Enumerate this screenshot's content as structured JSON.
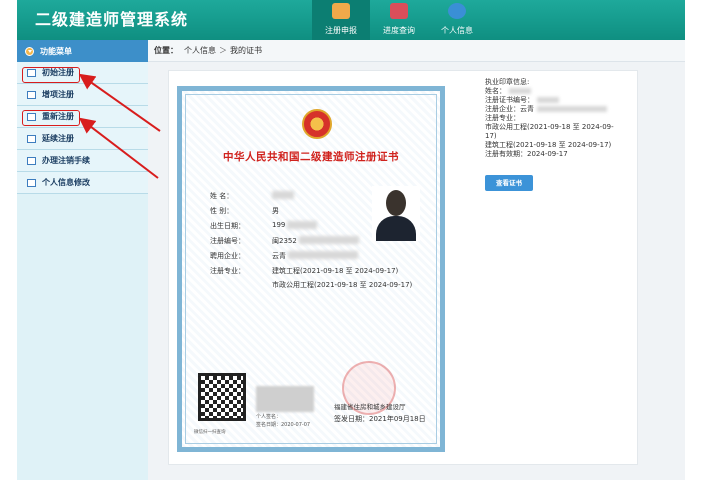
{
  "app": {
    "title": "二级建造师管理系统",
    "topnav": [
      {
        "label": "注册申报",
        "icon": "home-icon",
        "active": true
      },
      {
        "label": "进度查询",
        "icon": "monitor-icon",
        "active": false
      },
      {
        "label": "个人信息",
        "icon": "info-icon",
        "active": false
      }
    ]
  },
  "sidebar": {
    "header": "功能菜单",
    "items": [
      {
        "label": "初始注册"
      },
      {
        "label": "增项注册"
      },
      {
        "label": "重新注册"
      },
      {
        "label": "延续注册"
      },
      {
        "label": "办理注销手续"
      },
      {
        "label": "个人信息修改"
      }
    ]
  },
  "breadcrumb": {
    "prefix": "位置：",
    "items": [
      "个人信息",
      "我的证书"
    ],
    "sep": "＞"
  },
  "certificate": {
    "title": "中华人民共和国二级建造师注册证书",
    "fields": [
      {
        "key": "姓    名：",
        "value": ""
      },
      {
        "key": "性    别：",
        "value": "男"
      },
      {
        "key": "出生日期：",
        "value": "199"
      },
      {
        "key": "注册编号：",
        "value": "闽2352"
      },
      {
        "key": "聘用企业：",
        "value": "云青"
      },
      {
        "key": "注册专业：",
        "value": "建筑工程(2021-09-18 至 2024-09-17)"
      }
    ],
    "extra_specialty": "市政公用工程(2021-09-18 至 2024-09-17)",
    "qr_caption": "微信扫一扫查询",
    "signer_label": "个人签名：",
    "sign_date": "签名日期：2020-07-07",
    "issuer": "福建省住房和城乡建设厅",
    "issue_date": "签发日期：2021年09月18日"
  },
  "info": {
    "lines": [
      "执业印章信息:",
      "姓名：",
      "注册证书编号：",
      "注册企业：云青",
      "注册专业：",
      "市政公用工程(2021-09-18 至 2024-09-",
      "17)",
      "建筑工程(2021-09-18 至 2024-09-17)",
      "注册有效期：2024-09-17"
    ],
    "button": "查看证书"
  },
  "colors": {
    "header": "#1ea99b",
    "annotation": "#d81d1d",
    "cert_title": "#d0221d",
    "button": "#3c93d8"
  }
}
